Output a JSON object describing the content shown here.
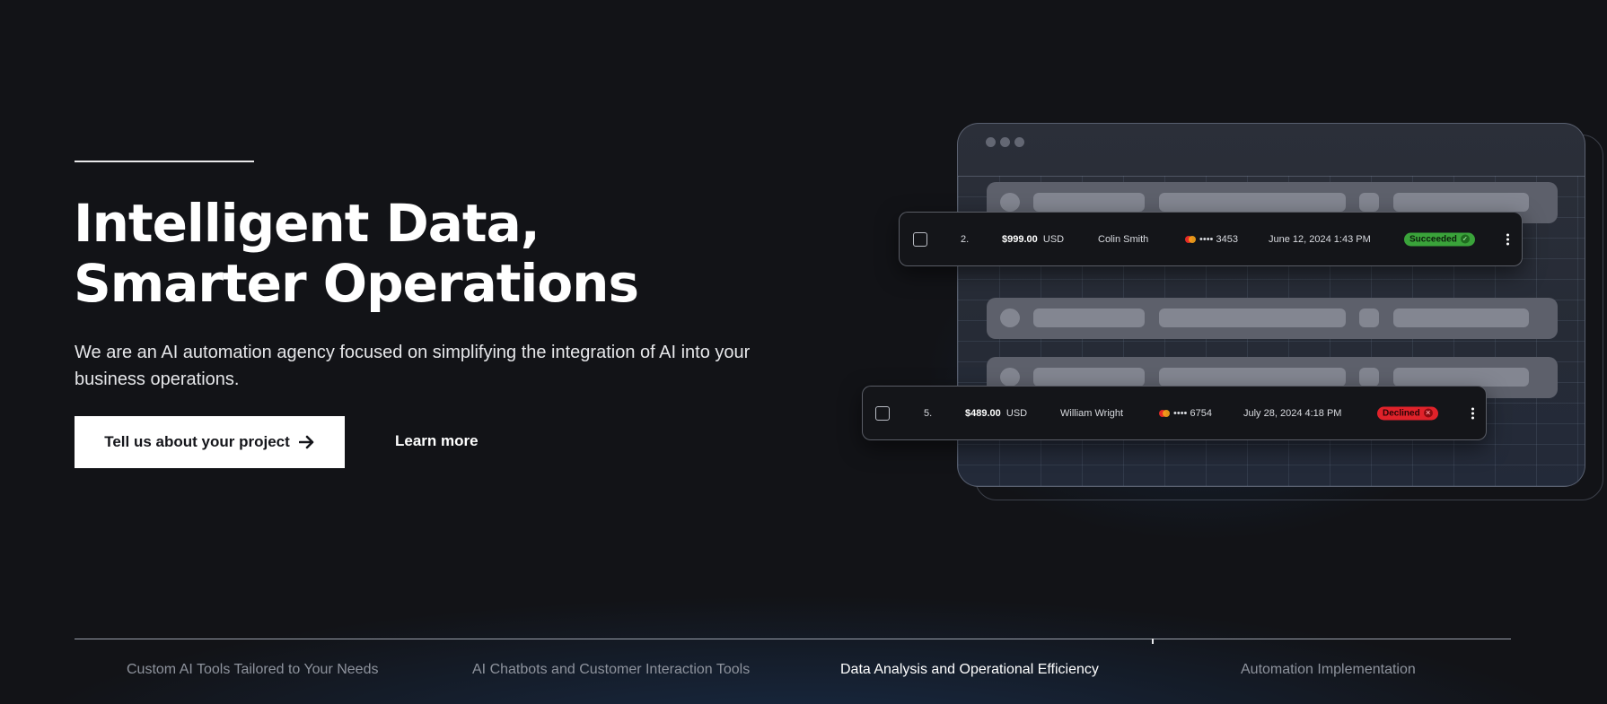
{
  "hero": {
    "title_line1": "Intelligent Data,",
    "title_line2": "Smarter Operations",
    "description": "We are an AI automation agency focused on simplifying the integration of AI into your business operations.",
    "cta_primary_label": "Tell us about your project",
    "cta_primary_icon": "arrow-right-icon",
    "cta_secondary_label": "Learn more"
  },
  "dashboard": {
    "transactions": [
      {
        "index": "2.",
        "amount": "$999.00",
        "currency": "USD",
        "customer": "Colin  Smith",
        "card_mask": "•••• 3453",
        "card_icon": "mastercard-icon",
        "datetime": "June 12, 2024  1:43 PM",
        "status": "Succeeded",
        "status_color": "#3aa33a"
      },
      {
        "index": "5.",
        "amount": "$489.00",
        "currency": "USD",
        "customer": "William  Wright",
        "card_mask": "•••• 6754",
        "card_icon": "mastercard-icon",
        "datetime": "July 28, 2024  4:18 PM",
        "status": "Declined",
        "status_color": "#e0222a"
      }
    ]
  },
  "tabs": [
    {
      "label": "Custom AI Tools Tailored to Your Needs",
      "active": false
    },
    {
      "label": "AI Chatbots and Customer Interaction Tools",
      "active": false
    },
    {
      "label": "Data Analysis and Operational Efficiency",
      "active": true
    },
    {
      "label": "Automation Implementation",
      "active": false
    }
  ],
  "colors": {
    "background": "#121317",
    "primary_button_bg": "#ffffff",
    "text": "#ffffff",
    "muted_text": "#8e939d"
  }
}
